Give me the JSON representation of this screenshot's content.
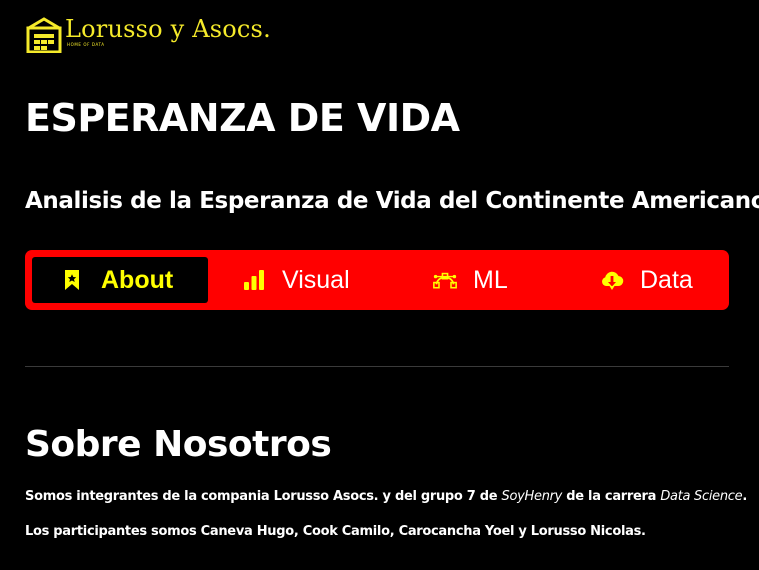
{
  "brand": {
    "name": "Lorusso y Asocs.",
    "tagline": "HOME OF DATA",
    "color": "#f5ea2a"
  },
  "page": {
    "title": "ESPERANZA DE VIDA",
    "subtitle": "Analisis de la Esperanza de Vida del Continente Americano"
  },
  "nav": {
    "background": "#ff0000",
    "active_color": "#ffff00",
    "items": [
      {
        "label": "About",
        "icon": "bookmark-icon",
        "active": true
      },
      {
        "label": "Visual",
        "icon": "bar-chart-icon",
        "active": false
      },
      {
        "label": "ML",
        "icon": "bezier-curve-icon",
        "active": false
      },
      {
        "label": "Data",
        "icon": "cloud-download-icon",
        "active": false
      }
    ]
  },
  "about": {
    "title": "Sobre Nosotros",
    "p1": {
      "before": "Somos integrantes de la compania Lorusso Asocs. y del grupo 7 de ",
      "em1": "SoyHenry",
      "middle": " de la carrera ",
      "em2": "Data Science",
      "after": "."
    },
    "p2": "Los participantes somos Caneva Hugo, Cook Camilo, Carocancha Yoel y Lorusso Nicolas."
  }
}
